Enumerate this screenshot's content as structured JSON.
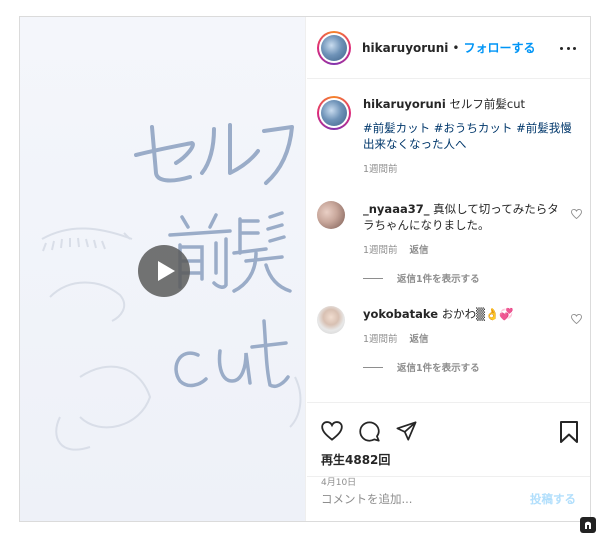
{
  "header": {
    "username": "hikaruyoruni",
    "separator": "•",
    "follow_label": "フォローする",
    "more_icon": "more-horizontal-icon"
  },
  "media": {
    "type": "video",
    "artwork_text": {
      "line1": "セルフ",
      "line2": "前髪",
      "line3": "cut"
    },
    "play_icon": "play-icon"
  },
  "caption": {
    "username": "hikaruyoruni",
    "text": "セルフ前髪cut",
    "hashtags": [
      "#前髪カット",
      "#おうちカット",
      "#前髪我慢出来なくなった人へ"
    ],
    "timestamp": "1週間前"
  },
  "comments": [
    {
      "username": "_nyaaa37_",
      "text": "真似して切ってみたらタラちゃんになりました。",
      "timestamp": "1週間前",
      "reply_label": "返信",
      "view_replies_label": "返信1件を表示する"
    },
    {
      "username": "yokobatake",
      "text": "おかわ▒👌💞",
      "timestamp": "1週間前",
      "reply_label": "返信",
      "view_replies_label": "返信1件を表示する"
    }
  ],
  "actions": {
    "icons": [
      "heart-icon",
      "comment-icon",
      "share-icon",
      "bookmark-icon"
    ],
    "views": "再生4882回",
    "date": "4月10日"
  },
  "add_comment": {
    "placeholder": "コメントを追加...",
    "post_label": "投稿する"
  },
  "colors": {
    "link_blue": "#0095f6",
    "hashtag_blue": "#00376b",
    "muted": "#8e8e8e",
    "border": "#dbdbdb",
    "post_disabled": "#b2dffc",
    "artwork_ink": "#8fa3c2"
  }
}
